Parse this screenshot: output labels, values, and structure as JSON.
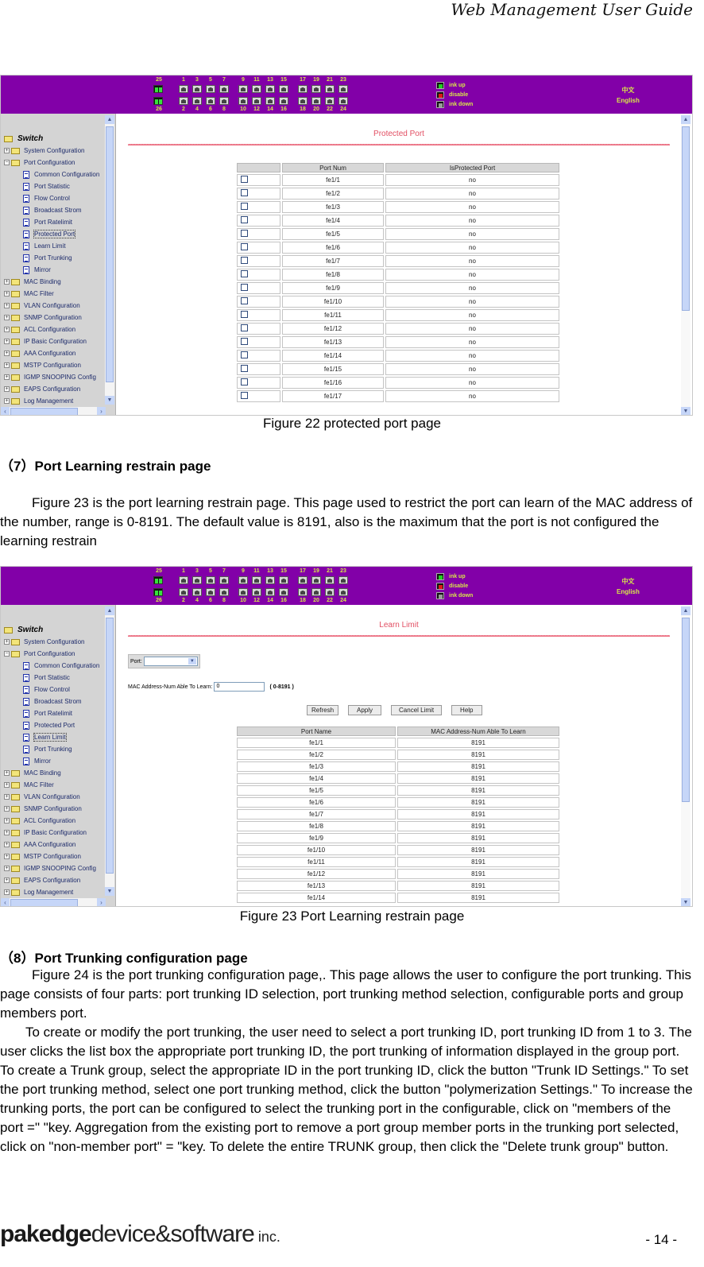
{
  "document": {
    "running_header": "Web Management User Guide",
    "page_number": "- 14 -",
    "footer_logo": {
      "bold": "pakedge",
      "light": "device&software",
      "suffix": " inc."
    }
  },
  "switch_ui": {
    "port_numbers_top": [
      "1",
      "3",
      "5",
      "7",
      "9",
      "11",
      "13",
      "15",
      "17",
      "19",
      "21",
      "23"
    ],
    "port_numbers_bottom": [
      "2",
      "4",
      "6",
      "8",
      "10",
      "12",
      "14",
      "16",
      "18",
      "20",
      "22",
      "24"
    ],
    "uplink_top": "25",
    "uplink_bottom": "26",
    "legend": [
      {
        "label": "ink up",
        "color": "#20d020"
      },
      {
        "label": "disable",
        "color": "#e01818"
      },
      {
        "label": "ink down",
        "color": "#9a9a9a"
      }
    ],
    "languages": [
      "中文",
      "English"
    ],
    "tree_root": "Switch",
    "tree": [
      {
        "label": "System Configuration",
        "type": "folder",
        "expanded": false
      },
      {
        "label": "Port Configuration",
        "type": "folder",
        "expanded": true
      },
      {
        "label": "Common Configuration",
        "type": "doc"
      },
      {
        "label": "Port Statistic",
        "type": "doc"
      },
      {
        "label": "Flow Control",
        "type": "doc"
      },
      {
        "label": "Broadcast Strom",
        "type": "doc"
      },
      {
        "label": "Port Ratelimit",
        "type": "doc"
      },
      {
        "label": "Protected Port",
        "type": "doc"
      },
      {
        "label": "Learn Limit",
        "type": "doc"
      },
      {
        "label": "Port Trunking",
        "type": "doc"
      },
      {
        "label": "Mirror",
        "type": "doc"
      },
      {
        "label": "MAC Binding",
        "type": "folder",
        "expanded": false
      },
      {
        "label": "MAC Filter",
        "type": "folder",
        "expanded": false
      },
      {
        "label": "VLAN Configuration",
        "type": "folder",
        "expanded": false
      },
      {
        "label": "SNMP Configuration",
        "type": "folder",
        "expanded": false
      },
      {
        "label": "ACL Configuration",
        "type": "folder",
        "expanded": false
      },
      {
        "label": "IP Basic Configuration",
        "type": "folder",
        "expanded": false
      },
      {
        "label": "AAA Configuration",
        "type": "folder",
        "expanded": false
      },
      {
        "label": "MSTP Configuration",
        "type": "folder",
        "expanded": false
      },
      {
        "label": "IGMP SNOOPING Config",
        "type": "folder",
        "expanded": false
      },
      {
        "label": "EAPS Configuration",
        "type": "folder",
        "expanded": false
      },
      {
        "label": "Log Management",
        "type": "folder",
        "expanded": false
      }
    ]
  },
  "figure22": {
    "selected_tree_item": "Protected Port",
    "panel_title": "Protected Port",
    "columns": [
      "",
      "Port Num",
      "IsProtected Port"
    ],
    "rows": [
      [
        "fe1/1",
        "no"
      ],
      [
        "fe1/2",
        "no"
      ],
      [
        "fe1/3",
        "no"
      ],
      [
        "fe1/4",
        "no"
      ],
      [
        "fe1/5",
        "no"
      ],
      [
        "fe1/6",
        "no"
      ],
      [
        "fe1/7",
        "no"
      ],
      [
        "fe1/8",
        "no"
      ],
      [
        "fe1/9",
        "no"
      ],
      [
        "fe1/10",
        "no"
      ],
      [
        "fe1/11",
        "no"
      ],
      [
        "fe1/12",
        "no"
      ],
      [
        "fe1/13",
        "no"
      ],
      [
        "fe1/14",
        "no"
      ],
      [
        "fe1/15",
        "no"
      ],
      [
        "fe1/16",
        "no"
      ],
      [
        "fe1/17",
        "no"
      ]
    ],
    "caption": "Figure 22 protected port page"
  },
  "section7": {
    "heading": "（7）Port Learning restrain page",
    "paragraph": "Figure 23 is the port learning restrain page. This page used to restrict the port can learn of the MAC address of the number, range is 0-8191. The default value is 8191, also is the maximum that the port is not configured the learning restrain"
  },
  "figure23": {
    "selected_tree_item": "Learn Limit",
    "panel_title": "Learn Limit",
    "port_label": "Port:",
    "port_value": "",
    "mac_label": "MAC Address-Num Able To Learn:",
    "mac_value": "0",
    "range_hint": "( 0-8191 )",
    "buttons": [
      "Refresh",
      "Apply",
      "Cancel Limit",
      "Help"
    ],
    "columns": [
      "Port Name",
      "MAC Address-Num Able To Learn"
    ],
    "rows": [
      [
        "fe1/1",
        "8191"
      ],
      [
        "fe1/2",
        "8191"
      ],
      [
        "fe1/3",
        "8191"
      ],
      [
        "fe1/4",
        "8191"
      ],
      [
        "fe1/5",
        "8191"
      ],
      [
        "fe1/6",
        "8191"
      ],
      [
        "fe1/7",
        "8191"
      ],
      [
        "fe1/8",
        "8191"
      ],
      [
        "fe1/9",
        "8191"
      ],
      [
        "fe1/10",
        "8191"
      ],
      [
        "fe1/11",
        "8191"
      ],
      [
        "fe1/12",
        "8191"
      ],
      [
        "fe1/13",
        "8191"
      ],
      [
        "fe1/14",
        "8191"
      ]
    ],
    "caption": "Figure 23 Port Learning restrain page"
  },
  "section8": {
    "heading": "（8）Port Trunking configuration page",
    "paragraph1": "Figure 24 is the port trunking configuration page,. This page allows the user to configure the port trunking. This page consists of four parts: port trunking ID selection, port trunking method selection, configurable ports and group members port.",
    "paragraph2": "To create or modify the port trunking, the user need to select a port trunking ID, port trunking ID from 1 to 3. The user clicks the list box the appropriate port trunking ID, the port trunking of information displayed in the group port. To create a Trunk group, select the appropriate ID in the port trunking ID, click the button \"Trunk ID Settings.\" To set the port trunking method, select one port trunking method, click the button \"polymerization Settings.\" To increase the trunking ports, the port can be configured to select the trunking port in the configurable, click on \"members of the port =\" \"key. Aggregation from the existing port to remove a port group member ports in the trunking port selected, click on \"non-member port\" = \"key. To delete the entire TRUNK group, then click the \"Delete trunk group\" button."
  }
}
